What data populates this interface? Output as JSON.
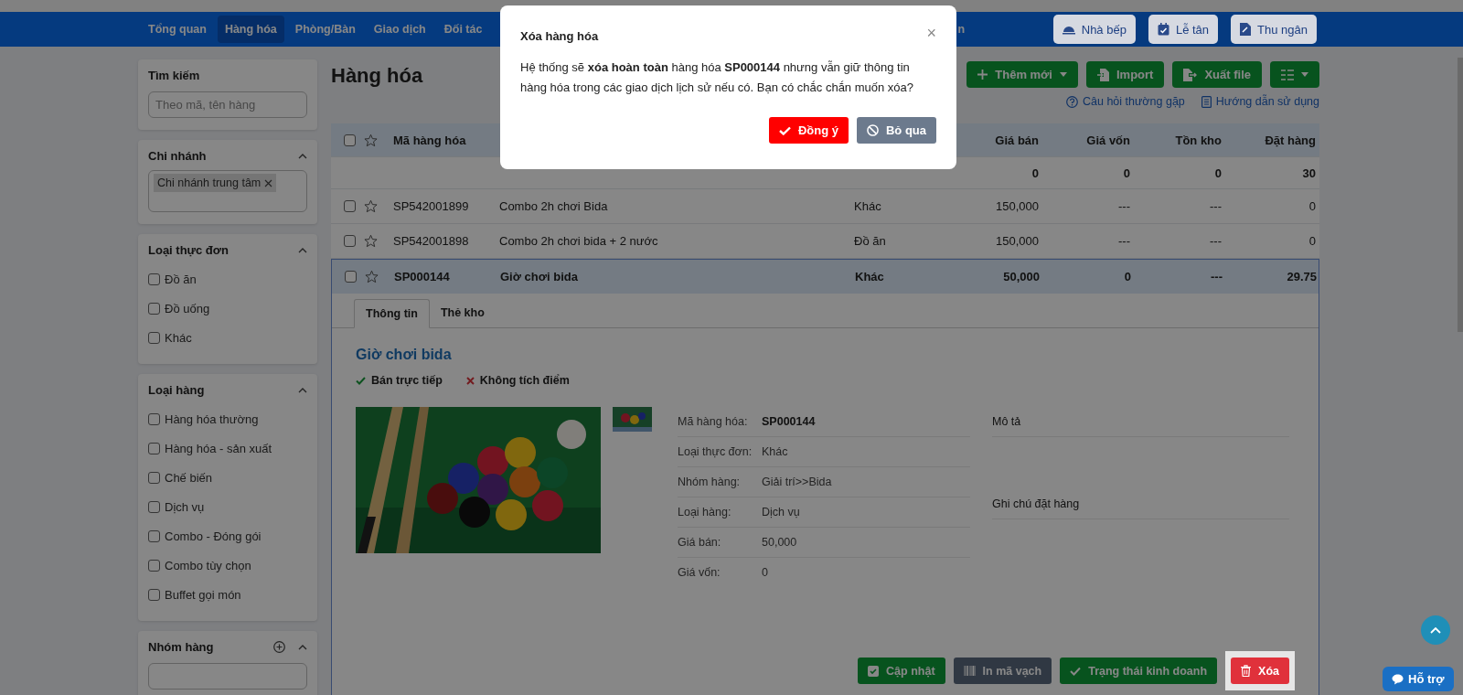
{
  "nav": {
    "items": [
      {
        "label": "Tổng quan",
        "selected": false
      },
      {
        "label": "Hàng hóa",
        "selected": true
      },
      {
        "label": "Phòng/Bàn",
        "selected": false
      },
      {
        "label": "Giao dịch",
        "selected": false
      },
      {
        "label": "Đối tác",
        "selected": false
      }
    ],
    "cut_item": "n",
    "buttons": [
      {
        "label": "Nhà bếp",
        "kind": "kitchen"
      },
      {
        "label": "Lễ tân",
        "kind": "reception"
      },
      {
        "label": "Thu ngân",
        "kind": "cashier"
      }
    ]
  },
  "sidebar": {
    "search": {
      "title": "Tìm kiếm",
      "placeholder": "Theo mã, tên hàng"
    },
    "branch": {
      "title": "Chi nhánh",
      "tags": [
        "Chi nhánh trung tâm"
      ]
    },
    "menu_type": {
      "title": "Loại thực đơn",
      "options": [
        {
          "label": "Đồ ăn",
          "checked": false
        },
        {
          "label": "Đồ uống",
          "checked": false
        },
        {
          "label": "Khác",
          "checked": false
        }
      ]
    },
    "item_type": {
      "title": "Loại hàng",
      "options": [
        {
          "label": "Hàng hóa thường",
          "checked": false
        },
        {
          "label": "Hàng hóa - sản xuất",
          "checked": false
        },
        {
          "label": "Chế biến",
          "checked": false
        },
        {
          "label": "Dịch vụ",
          "checked": false
        },
        {
          "label": "Combo - Đóng gói",
          "checked": false
        },
        {
          "label": "Combo tùy chọn",
          "checked": false
        },
        {
          "label": "Buffet gọi món",
          "checked": false
        }
      ]
    },
    "group": {
      "title": "Nhóm hàng"
    }
  },
  "page_title": "Hàng hóa",
  "toolbar": [
    {
      "label": "Thêm mới",
      "kind": "add"
    },
    {
      "label": "Import",
      "kind": "import"
    },
    {
      "label": "Xuất file",
      "kind": "export"
    },
    {
      "kind": "columns"
    }
  ],
  "help_links": [
    {
      "label": "Câu hỏi thường gặp",
      "kind": "faq"
    },
    {
      "label": "Hướng dẫn sử dụng",
      "kind": "guide"
    }
  ],
  "table": {
    "columns": [
      "Mã hàng hóa",
      "Giá bán",
      "Giá vốn",
      "Tồn kho",
      "Đặt hàng"
    ],
    "header_checked": false,
    "header_starred": false,
    "summary": {
      "price": "0",
      "cost": "0",
      "stock": "0",
      "order": "30"
    },
    "rows": [
      {
        "code": "SP542001899",
        "name": "Combo 2h chơi Bida",
        "menu_type": "Khác",
        "price": "150,000",
        "cost": "---",
        "stock": "---",
        "order": "0",
        "checked": false,
        "starred": false,
        "selected": false
      },
      {
        "code": "SP542001898",
        "name": "Combo 2h chơi bida + 2 nước",
        "menu_type": "Đồ ăn",
        "price": "150,000",
        "cost": "---",
        "stock": "---",
        "order": "0",
        "checked": false,
        "starred": false,
        "selected": false
      },
      {
        "code": "SP000144",
        "name": "Giờ chơi bida",
        "menu_type": "Khác",
        "price": "50,000",
        "cost": "0",
        "stock": "---",
        "order": "29.75",
        "checked": false,
        "starred": false,
        "selected": true
      }
    ]
  },
  "detail": {
    "tabs": [
      {
        "label": "Thông tin",
        "selected": true
      },
      {
        "label": "Thẻ kho",
        "selected": false
      }
    ],
    "title": "Giờ chơi bida",
    "flags": [
      {
        "label": "Bán trực tiếp",
        "on": true
      },
      {
        "label": "Không tích điểm",
        "on": false
      }
    ],
    "fields": [
      {
        "label": "Mã hàng hóa:",
        "value": "SP000144",
        "kind": "strong"
      },
      {
        "label": "Loại thực đơn:",
        "value": "Khác",
        "kind": "plain"
      },
      {
        "label": "Nhóm hàng:",
        "value": "Giải trí>>Bida",
        "kind": "plain"
      },
      {
        "label": "Loại hàng:",
        "value": "Dịch vụ",
        "kind": "plain"
      },
      {
        "label": "Giá bán:",
        "value": "50,000",
        "kind": "plain"
      },
      {
        "label": "Giá vốn:",
        "value": "0",
        "kind": "plain"
      }
    ],
    "notes": [
      "Mô tả",
      "Ghi chú đặt hàng"
    ],
    "actions": [
      {
        "label": "Cập nhật",
        "kind": "update",
        "highlighted": false
      },
      {
        "label": "In mã vạch",
        "kind": "barcode",
        "highlighted": false
      },
      {
        "label": "Trạng thái kinh doanh",
        "kind": "status",
        "highlighted": false
      },
      {
        "label": "Xóa",
        "kind": "delete",
        "highlighted": true
      }
    ]
  },
  "modal": {
    "title": "Xóa hàng hóa",
    "close": "×",
    "message": "Hệ thống sẽ **xóa hoàn toàn** hàng hóa **SP000144** nhưng vẫn giữ thông tin hàng hóa trong các giao dịch lịch sử nếu có. Bạn có chắc chắn muốn xóa?",
    "buttons": [
      {
        "label": "Đồng ý",
        "kind": "confirm"
      },
      {
        "label": "Bỏ qua",
        "kind": "cancel"
      }
    ]
  },
  "support": "Hỗ trợ"
}
